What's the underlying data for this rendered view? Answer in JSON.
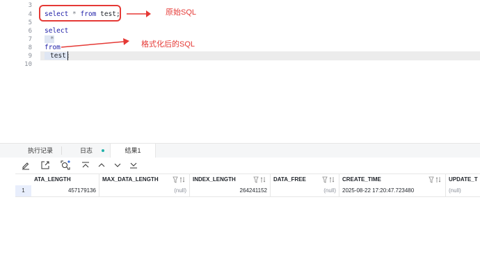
{
  "editor": {
    "line_numbers": [
      "3",
      "4",
      "5",
      "6",
      "7",
      "8",
      "9",
      "10"
    ],
    "line4": {
      "kw1": "select",
      "sym": " * ",
      "kw2": "from",
      "rest": " test;"
    },
    "line6": "select",
    "line7": "*",
    "line8": "from",
    "line9": "test;"
  },
  "annotations": {
    "original_sql": "原始SQL",
    "formatted_sql": "格式化后的SQL"
  },
  "tabs": [
    {
      "label": "执行记录"
    },
    {
      "label": "日志"
    },
    {
      "label": "结果1"
    }
  ],
  "toolbar": {
    "icons": [
      "edit-icon",
      "export-icon",
      "refresh-search-icon",
      "first-row-icon",
      "prev-row-icon",
      "next-row-icon",
      "last-row-icon"
    ]
  },
  "grid": {
    "columns": [
      "ATA_LENGTH",
      "MAX_DATA_LENGTH",
      "INDEX_LENGTH",
      "DATA_FREE",
      "CREATE_TIME",
      "UPDATE_T"
    ],
    "rows": [
      {
        "row_num": "1",
        "cells": [
          "457179136",
          "(null)",
          "264241152",
          "(null)",
          "2025-08-22 17:20:47.723480",
          "(null)"
        ]
      }
    ]
  },
  "colors": {
    "annotation_red": "#e53935",
    "keyword_blue": "#1a1aa6",
    "status_dot": "#20b2aa",
    "selected_row_bg": "#e8eefc"
  }
}
